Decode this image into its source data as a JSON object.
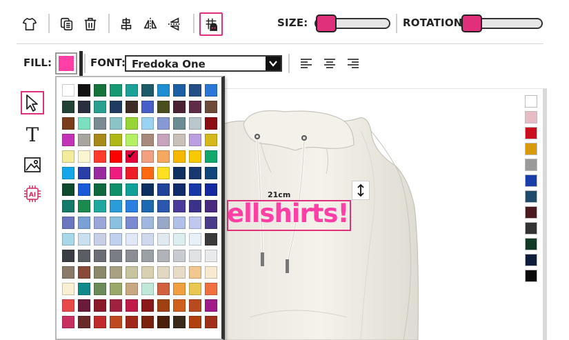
{
  "toolbar": {
    "icons": [
      "tshirt-icon",
      "duplicate-icon",
      "trash-icon",
      "align-center-icon",
      "flip-horizontal-icon",
      "flip-vertical-icon",
      "smart-grid-icon"
    ],
    "size_label": "SIZE:",
    "rotation_label": "ROTATION:",
    "size_value": 0.05,
    "rotation_value": 0.05
  },
  "fill": {
    "label": "FILL:",
    "color": "#ff3fa6"
  },
  "font": {
    "label": "FONT:",
    "value": "Fredoka One"
  },
  "alignment": [
    "align-left-icon",
    "align-center-icon",
    "align-right-icon"
  ],
  "left_tools": [
    "select-cursor-icon",
    "text-tool-icon",
    "image-tool-icon",
    "ai-tool-icon"
  ],
  "design": {
    "size_tag": "21cm",
    "text": "ellshirts!",
    "text_color": "#ff3fa6"
  },
  "right_palette": [
    "#ffffff",
    "#e8bcc4",
    "#c8101e",
    "#d89a0a",
    "#9a9a9a",
    "#1a3ea8",
    "#1e4b6a",
    "#4a1a1e",
    "#333333",
    "#113a24",
    "#0e1e3a",
    "#0a0a0a"
  ],
  "palette": {
    "selected_index": 44,
    "colors": [
      "#ffffff",
      "#111111",
      "#14743a",
      "#179a74",
      "#1aa19a",
      "#1d5b6b",
      "#1f8fd3",
      "#1d5fa5",
      "#244f86",
      "#2b77d6",
      "#214235",
      "#2a2f40",
      "#2a9f92",
      "#203b62",
      "#3e2d24",
      "#4760c8",
      "#4b4f1e",
      "#4a2234",
      "#5e2c48",
      "#6e4a3b",
      "#7a3d1b",
      "#7ae0c0",
      "#7a8b94",
      "#8ac4c8",
      "#98d434",
      "#9bd4f2",
      "#8799d4",
      "#6a8c92",
      "#b9c6cc",
      "#8b0d12",
      "#c233b8",
      "#a8a49e",
      "#a88a1a",
      "#b0b818",
      "#b4f064",
      "#a98a7a",
      "#c6a4bc",
      "#c9c0b8",
      "#bc9fe0",
      "#d6b81c",
      "#f2ec9c",
      "#fbf6d2",
      "#ff3b2f",
      "#ff0000",
      "#e4003a",
      "#f2a080",
      "#f6a860",
      "#f8b800",
      "#f8c800",
      "#12a86c",
      "#14a8e8",
      "#2a3ea8",
      "#9a2aa0",
      "#ee1c7e",
      "#ee1c24",
      "#ff6a10",
      "#ffe020",
      "#103060",
      "#183870",
      "#10467a",
      "#0e4a2e",
      "#1a5ad8",
      "#0e6a3e",
      "#10906a",
      "#10a09a",
      "#0c3060",
      "#20449a",
      "#102c6a",
      "#1838a8",
      "#1428a0",
      "#147a6a",
      "#1a8a4e",
      "#20a8a0",
      "#2a9cd8",
      "#2a80e0",
      "#1e6ab0",
      "#2a58b0",
      "#4a3a9a",
      "#3a3288",
      "#4a2a80",
      "#6a76c0",
      "#7aa0d8",
      "#9aa6d8",
      "#8ac0e0",
      "#7a8ad0",
      "#a0b8e0",
      "#98a8c8",
      "#b0c0e8",
      "#c0c8f0",
      "#4a3c8a",
      "#a8d8e8",
      "#c8e0f0",
      "#c8d0e8",
      "#c0d0f0",
      "#e0e8f8",
      "#d0d8f0",
      "#e0eaf0",
      "#dceef0",
      "#e8f0f8",
      "#3a3a3a",
      "#3a3e44",
      "#5a5e64",
      "#6a6e74",
      "#7a7e84",
      "#8a8e94",
      "#9aa0a6",
      "#b0b4b8",
      "#c8ccd0",
      "#e0e2e4",
      "#e8eaec",
      "#8a7a6a",
      "#8a4a3a",
      "#8a8a6a",
      "#a8a080",
      "#c8c4a0",
      "#d8d0b0",
      "#e0d8c0",
      "#e8dcc8",
      "#f0c890",
      "#f8ead0",
      "#f8f0d0",
      "#0f8a8a",
      "#6a8a5a",
      "#9aa86a",
      "#c8a880",
      "#c0e8d8",
      "#d06040",
      "#f0a040",
      "#e8c850",
      "#f07040",
      "#e84a4a",
      "#6a1a3a",
      "#8a1a2a",
      "#a02040",
      "#c01a4a",
      "#8a1a1a",
      "#a04010",
      "#d06020",
      "#b84a20",
      "#a01a8a",
      "#c83060",
      "#6a2a2a",
      "#c02a2a",
      "#c04a20",
      "#a0281a",
      "#7a2410",
      "#4a200a",
      "#3a2a1a",
      "#b04010",
      "#a0301a"
    ]
  }
}
